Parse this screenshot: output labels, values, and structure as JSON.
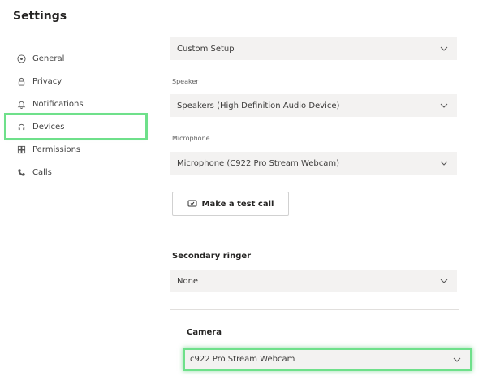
{
  "page": {
    "title": "Settings"
  },
  "sidebar": {
    "items": [
      {
        "label": "General",
        "icon": "general-icon"
      },
      {
        "label": "Privacy",
        "icon": "lock-icon"
      },
      {
        "label": "Notifications",
        "icon": "bell-icon"
      },
      {
        "label": "Devices",
        "icon": "headset-icon",
        "selected": true
      },
      {
        "label": "Permissions",
        "icon": "grid-icon"
      },
      {
        "label": "Calls",
        "icon": "phone-icon"
      }
    ]
  },
  "devices": {
    "audio_setup": "Custom Setup",
    "speaker_label": "Speaker",
    "speaker_value": "Speakers (High Definition Audio Device)",
    "microphone_label": "Microphone",
    "microphone_value": "Microphone (C922 Pro Stream Webcam)",
    "test_call_label": "Make a test call",
    "secondary_ringer_label": "Secondary ringer",
    "secondary_ringer_value": "None",
    "camera_label": "Camera",
    "camera_value": "c922 Pro Stream Webcam"
  },
  "colors": {
    "highlight": "#6ee08a",
    "dropdown_bg": "#f3f2f1"
  }
}
